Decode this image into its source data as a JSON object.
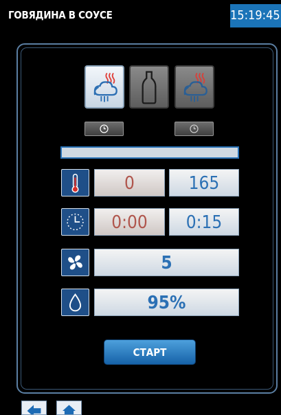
{
  "header": {
    "title": "ГОВЯДИНА В СОУСЕ",
    "clock": "15:19:45"
  },
  "modes": [
    {
      "icon": "steam-convection-icon",
      "state": "active"
    },
    {
      "icon": "bottle-icon",
      "state": "inactive"
    },
    {
      "icon": "steam-convection-icon",
      "state": "inactive"
    }
  ],
  "timers": [
    {
      "icon": "clock-icon"
    },
    {
      "icon": "clock-icon"
    }
  ],
  "progress": {
    "value": 0
  },
  "parameters": {
    "temperature": {
      "actual": "0",
      "set": "165",
      "icon": "thermometer-icon"
    },
    "time": {
      "actual": "0:00",
      "set": "0:15",
      "icon": "stopwatch-icon"
    },
    "fan": {
      "value": "5",
      "icon": "fan-icon"
    },
    "humidity": {
      "value": "95%",
      "icon": "water-drop-icon"
    }
  },
  "actions": {
    "start_label": "СТАРТ"
  },
  "nav": {
    "back_icon": "arrow-left-icon",
    "home_icon": "home-icon"
  },
  "colors": {
    "accent": "#1b74b8",
    "actual_value": "#b0564d",
    "set_value": "#2b70b4"
  }
}
